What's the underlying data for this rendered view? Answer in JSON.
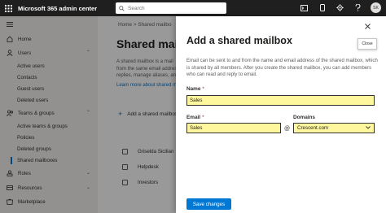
{
  "topbar": {
    "app_title": "Microsoft 365 admin center",
    "search_placeholder": "Search",
    "avatar_initials": "SK",
    "icons": [
      "waffle-icon",
      "search-icon",
      "terminal-icon",
      "mobile-icon",
      "settings-icon",
      "help-icon"
    ]
  },
  "nav": {
    "items": [
      {
        "label": "Home",
        "icon": "home-icon"
      },
      {
        "label": "Users",
        "icon": "user-icon",
        "expanded": true
      },
      {
        "label": "Active users"
      },
      {
        "label": "Contacts"
      },
      {
        "label": "Guest users"
      },
      {
        "label": "Deleted users"
      },
      {
        "label": "Teams & groups",
        "icon": "team-icon",
        "expanded": true
      },
      {
        "label": "Active teams & groups"
      },
      {
        "label": "Policies"
      },
      {
        "label": "Deleted groups"
      },
      {
        "label": "Shared mailboxes",
        "active": true
      },
      {
        "label": "Roles",
        "icon": "roles-icon"
      },
      {
        "label": "Resources",
        "icon": "resources-icon"
      },
      {
        "label": "Marketplace",
        "icon": "marketplace-icon"
      }
    ]
  },
  "main": {
    "breadcrumb": "Home > Shared mailbo",
    "title": "Shared mailbo",
    "desc_lines": [
      "A shared mailbox is a mail",
      "from the same email addres",
      "replies, manage aliases, and"
    ],
    "link": "Learn more about shared m",
    "add_label": "Add a shared mailbox",
    "rows": [
      "Griselda Sicilian",
      "Helpdesk",
      "Investors"
    ]
  },
  "panel": {
    "title": "Add a shared mailbox",
    "description": "Email can be sent to and from the name and email address of the shared mailbox, which is shared by all members. After you create the shared mailbox, you can add members who can read and reply to email.",
    "close_tooltip": "Close",
    "name_label": "Name",
    "name_value": "Sales",
    "email_label": "Email",
    "email_value": "Sales",
    "at_symbol": "@",
    "domains_label": "Domains",
    "domain_value": "Crescent.com",
    "save_label": "Save changes",
    "highlight_color": "#fff79e",
    "accent_color": "#0078d4"
  }
}
